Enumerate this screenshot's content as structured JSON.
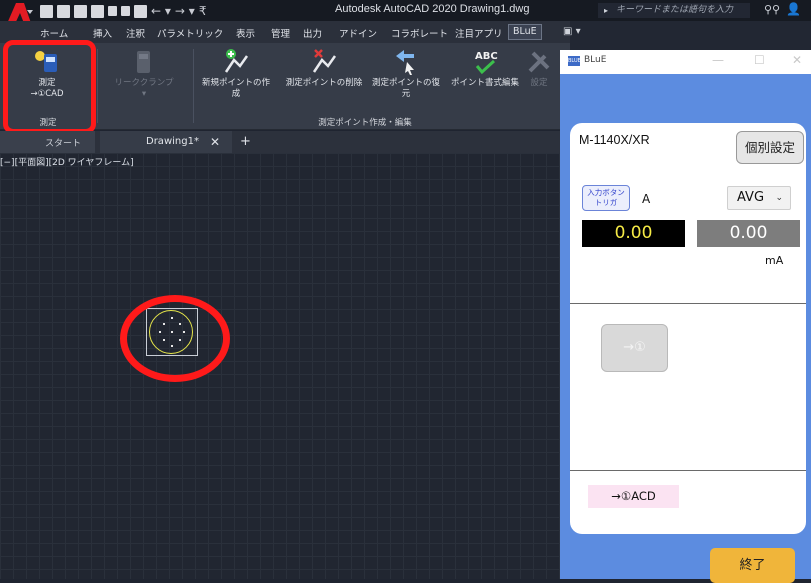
{
  "app": {
    "title": "Autodesk AutoCAD 2020   Drawing1.dwg",
    "search_placeholder": "キーワードまたは語句を入力"
  },
  "ribbon_tabs": [
    "ホーム",
    "挿入",
    "注釈",
    "パラメトリック",
    "表示",
    "管理",
    "出力",
    "アドイン",
    "コラボレート",
    "注目アプリ",
    "BLuE"
  ],
  "ribbon": {
    "measure_label": "測定",
    "measure_sub": "→①CAD",
    "leakclamp_label": "リーククランプ",
    "new_point": "新規ポイントの作成",
    "delete_point": "測定ポイントの削除",
    "restore_point": "測定ポイントの復元",
    "edit_format": "ポイント書式編集",
    "settings": "設定",
    "panel1": "測定",
    "panel2": "測定ポイント作成・編集"
  },
  "doc_tabs": {
    "start": "スタート",
    "drawing": "Drawing1*"
  },
  "viewport_label": "[−][平面図][2D ワイヤフレーム]",
  "blue": {
    "window_title": "BLuE",
    "model": "M-1140X/XR",
    "indiv_settings": "個別設定",
    "trigger_label_1": "入力ボタン",
    "trigger_label_2": "トリガ",
    "unit_top": "A",
    "mode": "AVG",
    "value_main": "0.00",
    "value_sub": "0.00",
    "unit_bottom": "mA",
    "send_button": "→①",
    "result_label": "→①ACD",
    "exit_button": "終了"
  },
  "colors": {
    "highlight": "#ff1a1a",
    "blue_bg": "#5c8ce0",
    "exit": "#f0b53a"
  }
}
